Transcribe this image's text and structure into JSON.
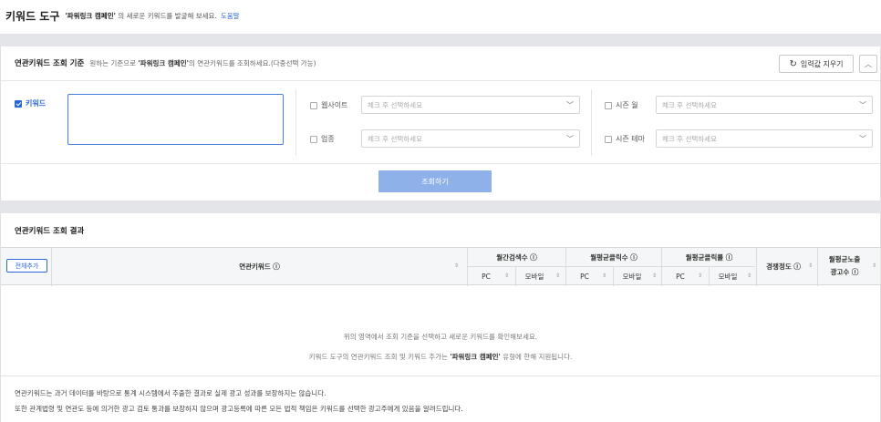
{
  "header": {
    "title": "키워드 도구",
    "desc_quote": "'파워링크 캠페인'",
    "desc_rest": " 의 새로운 키워드를 발굴해 보세요.",
    "help": "도움말"
  },
  "search_panel": {
    "title": "연관키워드 조회 기준",
    "desc_pre": "원하는 기준으로 ",
    "desc_quote": "'파워링크 캠페인'",
    "desc_post": "의 연관키워드를 조회하세요.(다중선택 가능)",
    "reset_label": "입력값 지우기",
    "keyword_label": "키워드",
    "keyword_value": "",
    "fields": {
      "website": {
        "label": "웹사이트",
        "placeholder": "체크 후 선택하세요"
      },
      "industry": {
        "label": "업종",
        "placeholder": "체크 후 선택하세요"
      },
      "season_month": {
        "label": "시즌 월",
        "placeholder": "체크 후 선택하세요"
      },
      "season_theme": {
        "label": "시즌 테마",
        "placeholder": "체크 후 선택하세요"
      }
    },
    "search_button": "조회하기"
  },
  "results_panel": {
    "title": "연관키워드 조회 결과",
    "add_all": "전체추가",
    "columns": {
      "keyword": "연관키워드 ⓘ",
      "monthly_search": "월간검색수 ⓘ",
      "avg_clicks": "월평균클릭수 ⓘ",
      "avg_ctr": "월평균클릭률 ⓘ",
      "competition": "경쟁정도 ⓘ",
      "avg_ads_l1": "월평균노출",
      "avg_ads_l2": "광고수 ⓘ",
      "pc": "PC",
      "mobile": "모바일"
    },
    "empty_line1": "위의 영역에서 조회 기준을 선택하고 새로운 키워드를 확인해보세요.",
    "empty_line2_pre": "키워드 도구의 연관키워드 조회 및 키워드 추가는 ",
    "empty_line2_quote": "'파워링크 캠페인'",
    "empty_line2_post": " 유형에 한해 지원됩니다.",
    "notes": [
      "연관키워드는 과거 데이터를 바탕으로 통계 시스템에서 추출한 결과로 실제 광고 성과를 보장하지는 않습니다.",
      "또한 관계법령 및 연관도 등에 의거한 광고 검토 통과를 보장하지 않으며 광고등록에 따른 모든 법적 책임은 키워드를 선택한 광고주에게 있음을 알려드립니다."
    ]
  }
}
